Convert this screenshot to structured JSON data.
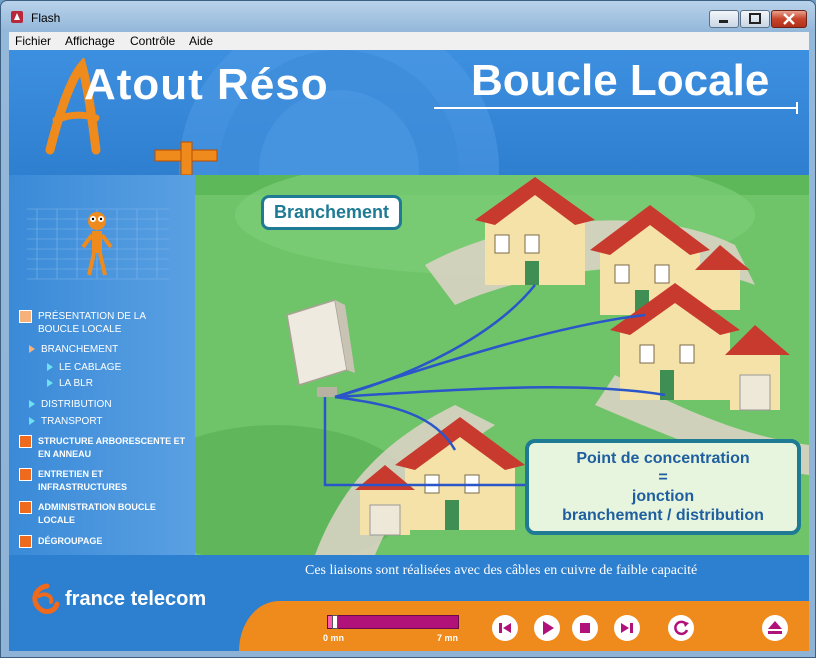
{
  "window": {
    "title": "Flash"
  },
  "menu": {
    "file": "Fichier",
    "view": "Affichage",
    "control": "Contrôle",
    "help": "Aide"
  },
  "header": {
    "logo_text": "Atout Réso",
    "title": "Boucle Locale"
  },
  "scene": {
    "tag": "Branchement",
    "callout_line1": "Point de concentration",
    "callout_line2": "=",
    "callout_line3": "jonction",
    "callout_line4": "branchement / distribution"
  },
  "nav": {
    "items": [
      {
        "label": "PRÉSENTATION DE LA BOUCLE LOCALE"
      },
      {
        "label": "BRANCHEMENT"
      },
      {
        "label": "LE CABLAGE"
      },
      {
        "label": "LA BLR"
      },
      {
        "label": "DISTRIBUTION"
      },
      {
        "label": "TRANSPORT"
      },
      {
        "label": "STRUCTURE ARBORESCENTE ET EN ANNEAU"
      },
      {
        "label": "ENTRETIEN ET INFRASTRUCTURES"
      },
      {
        "label": "ADMINISTRATION BOUCLE LOCALE"
      },
      {
        "label": "DÉGROUPAGE"
      }
    ]
  },
  "caption": "Ces liaisons sont réalisées avec des câbles en cuivre de faible capacité",
  "brand": "france telecom",
  "player": {
    "start_label": "0 mn",
    "end_label": "7 mn",
    "progress": 0.03
  },
  "colors": {
    "accent": "#ef8a1c",
    "brand_blue": "#2d7fd0",
    "callout_border": "#1f7a94",
    "progress_track": "#b0127a"
  }
}
